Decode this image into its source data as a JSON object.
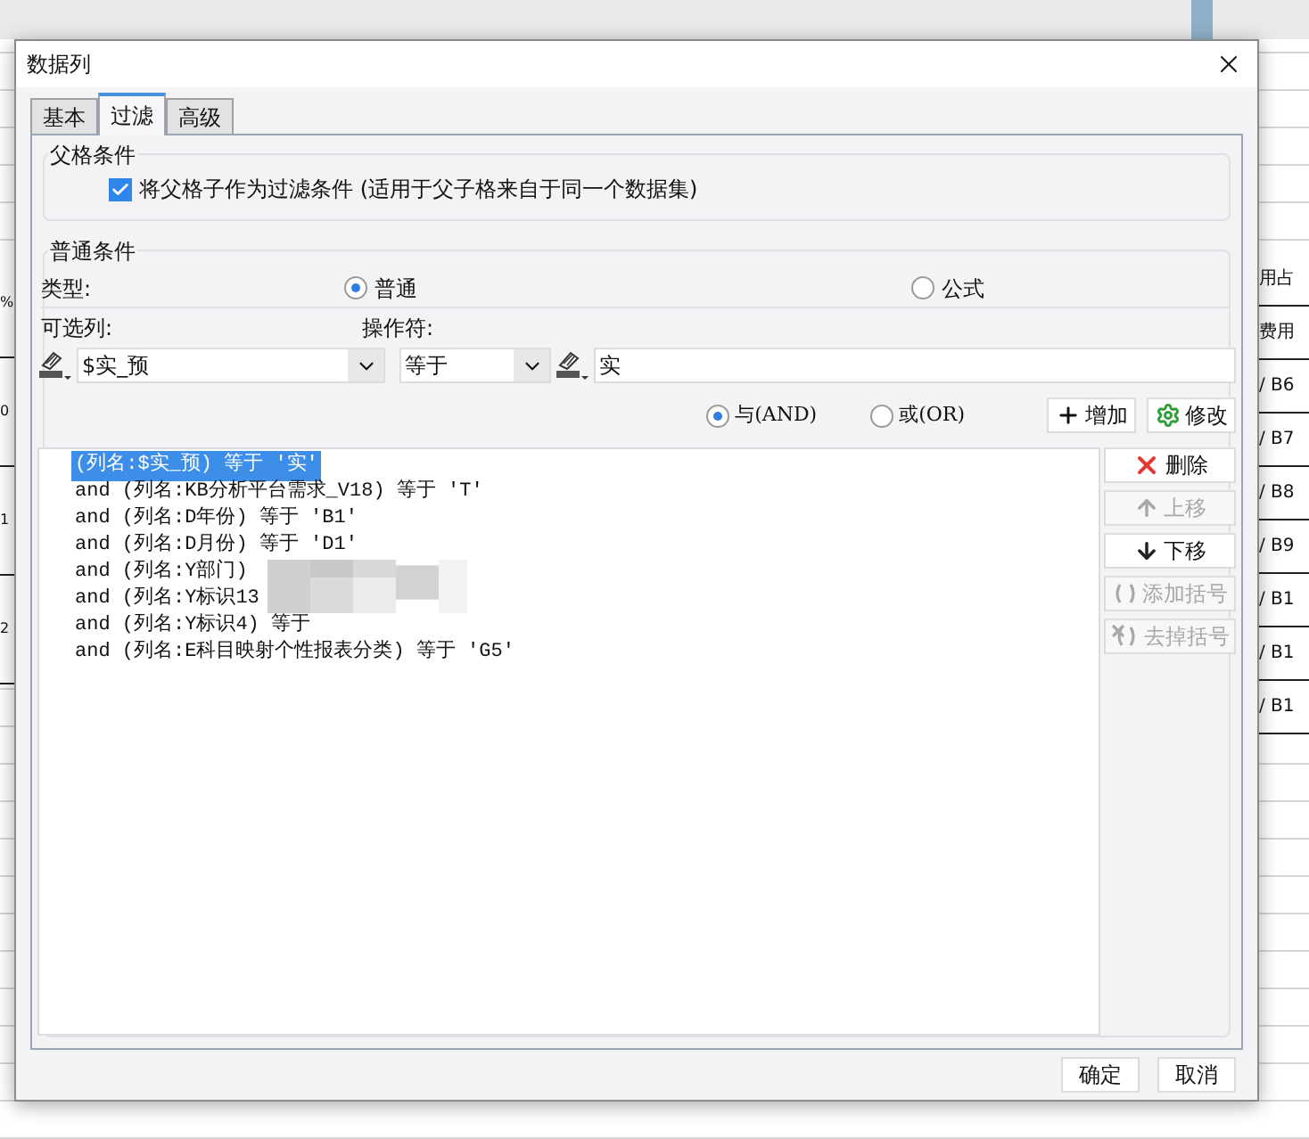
{
  "window": {
    "title": "数据列"
  },
  "tabs": [
    {
      "label": "基本",
      "selected": false
    },
    {
      "label": "过滤",
      "selected": true
    },
    {
      "label": "高级",
      "selected": false
    }
  ],
  "parent_condition": {
    "legend": "父格条件",
    "checkbox": {
      "label": "将父格子作为过滤条件 (适用于父子格来自于同一个数据集)",
      "checked": true
    }
  },
  "normal_condition": {
    "legend": "普通条件",
    "type_label": "类型:",
    "type_options": [
      {
        "label": "普通",
        "selected": true
      },
      {
        "label": "公式",
        "selected": false
      }
    ],
    "column_label": "可选列:",
    "operator_label": "操作符:",
    "column_value": "$实_预",
    "operator_value": "等于",
    "value": "实",
    "logic_options": [
      {
        "label": "与(AND)",
        "selected": true
      },
      {
        "label": "或(OR)",
        "selected": false
      }
    ],
    "add_button": "增加",
    "modify_button": "修改",
    "conditions": [
      {
        "text": "(列名:$实_预) 等于 '实'",
        "selected": true
      },
      {
        "text": "and (列名:KB分析平台需求_V18) 等于 'T'",
        "selected": false
      },
      {
        "text": "and (列名:D年份) 等于 'B1'",
        "selected": false
      },
      {
        "text": "and (列名:D月份) 等于 'D1'",
        "selected": false
      },
      {
        "text": "and (列名:Y部门)",
        "selected": false
      },
      {
        "text": "and (列名:Y标识13",
        "selected": false
      },
      {
        "text": "and (列名:Y标识4) 等于",
        "selected": false
      },
      {
        "text": "and (列名:E科目映射个性报表分类) 等于 'G5'",
        "selected": false
      }
    ],
    "side_buttons": [
      {
        "label": "删除",
        "kind": "delete",
        "disabled": false
      },
      {
        "label": "上移",
        "kind": "up",
        "disabled": true
      },
      {
        "label": "下移",
        "kind": "down",
        "disabled": false
      },
      {
        "label": "添加括号",
        "kind": "add_paren",
        "disabled": true
      },
      {
        "label": "去掉括号",
        "kind": "remove_paren",
        "disabled": true
      }
    ]
  },
  "footer_buttons": [
    "确定",
    "取消"
  ],
  "background": {
    "left_cells": [
      "%",
      "0",
      "1",
      "2"
    ],
    "right_cells": [
      "用占",
      "费用",
      "/ B6",
      "/ B7",
      "/ B8",
      "/ B9",
      "/ B1",
      "/ B1",
      "/ B1"
    ]
  }
}
